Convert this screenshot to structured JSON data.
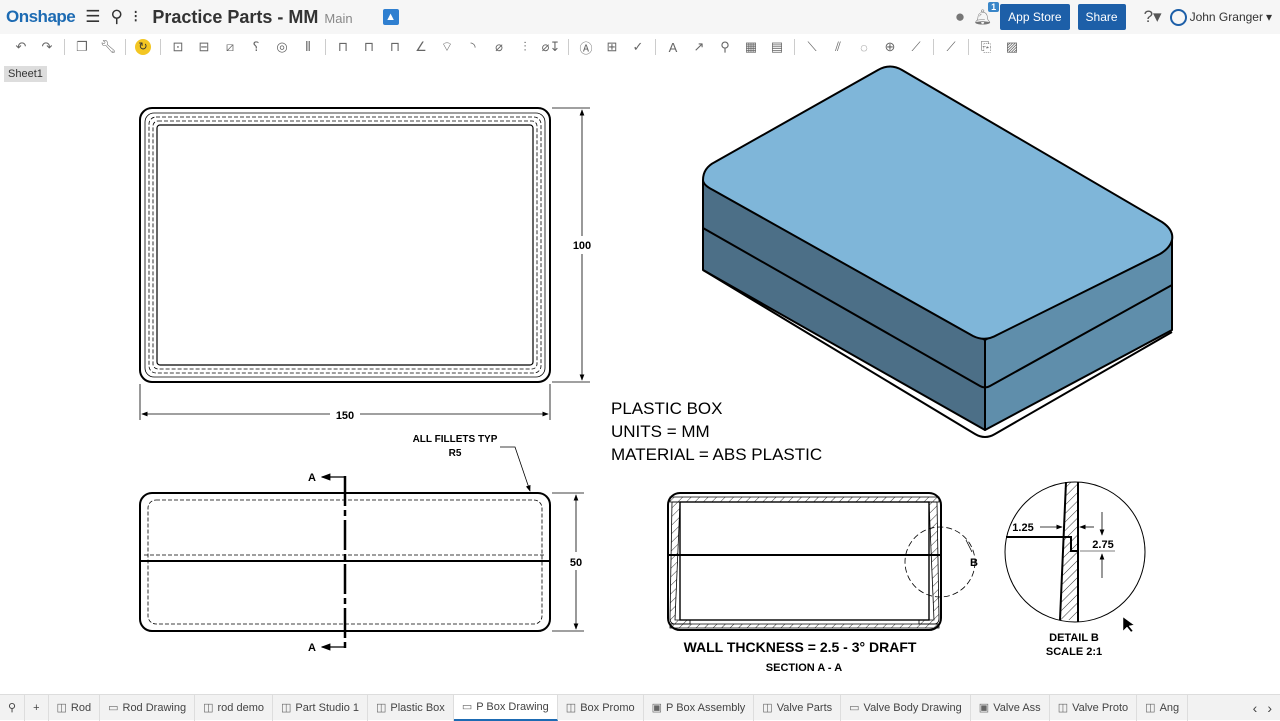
{
  "header": {
    "logo": "Onshape",
    "title": "Practice Parts - MM",
    "branch": "Main",
    "app_store": "App Store",
    "share": "Share",
    "notifications": "1",
    "user": "John Granger",
    "icons": [
      "menu-icon",
      "feature-list-icon",
      "insert-icon",
      "education-icon",
      "comment-icon",
      "bell-icon",
      "help-icon"
    ]
  },
  "toolbar": {
    "icons": [
      "undo",
      "redo",
      "|",
      "views",
      "wrench",
      "|",
      "update",
      "|",
      "insert-view",
      "projected-view",
      "section-view",
      "detail-view",
      "auxiliary-view",
      "break-view",
      "|",
      "dim-linear",
      "dim-baseline",
      "dim-chain",
      "dim-angle",
      "dim-radius",
      "dim-arc",
      "dim-diameter",
      "dim-ordinate",
      "hole-callout",
      "|",
      "note",
      "datum",
      "surface-finish",
      "|",
      "text",
      "leader",
      "balloon",
      "table",
      "bom",
      "|",
      "centerline",
      "centermark",
      "circle-center",
      "center",
      "cosmetic",
      "|",
      "line",
      "|",
      "export",
      "image"
    ]
  },
  "sheet": {
    "label": "Sheet1"
  },
  "drawing": {
    "dim_100": "100",
    "dim_150": "150",
    "dim_50": "50",
    "fillet_note_1": "ALL FILLETS TYP",
    "fillet_note_2": "R5",
    "section_a": "A",
    "note_1": "PLASTIC BOX",
    "note_2": "UNITS = MM",
    "note_3": "MATERIAL = ABS PLASTIC",
    "wall_note": "WALL THCKNESS = 2.5 - 3° DRAFT",
    "section_label": "SECTION A - A",
    "detail_b": "B",
    "dim_125": "1.25",
    "dim_275": "2.75",
    "detail_label": "DETAIL B",
    "detail_scale": "SCALE 2:1",
    "colors": {
      "top_face": "#7fb6d9",
      "front_face": "#4c6f87",
      "side_face": "#5f8eab"
    }
  },
  "tabs": [
    {
      "label": "Rod",
      "type": "part-studio"
    },
    {
      "label": "Rod Drawing",
      "type": "drawing"
    },
    {
      "label": "rod demo",
      "type": "part-studio"
    },
    {
      "label": "Part Studio 1",
      "type": "part-studio"
    },
    {
      "label": "Plastic Box",
      "type": "part-studio"
    },
    {
      "label": "P Box Drawing",
      "type": "drawing",
      "active": true
    },
    {
      "label": "Box Promo",
      "type": "part-studio"
    },
    {
      "label": "P Box Assembly",
      "type": "assembly"
    },
    {
      "label": "Valve Parts",
      "type": "part-studio"
    },
    {
      "label": "Valve Body Drawing",
      "type": "drawing"
    },
    {
      "label": "Valve Ass",
      "type": "assembly"
    },
    {
      "label": "Valve Proto",
      "type": "part-studio"
    },
    {
      "label": "Ang",
      "type": "part-studio"
    }
  ]
}
